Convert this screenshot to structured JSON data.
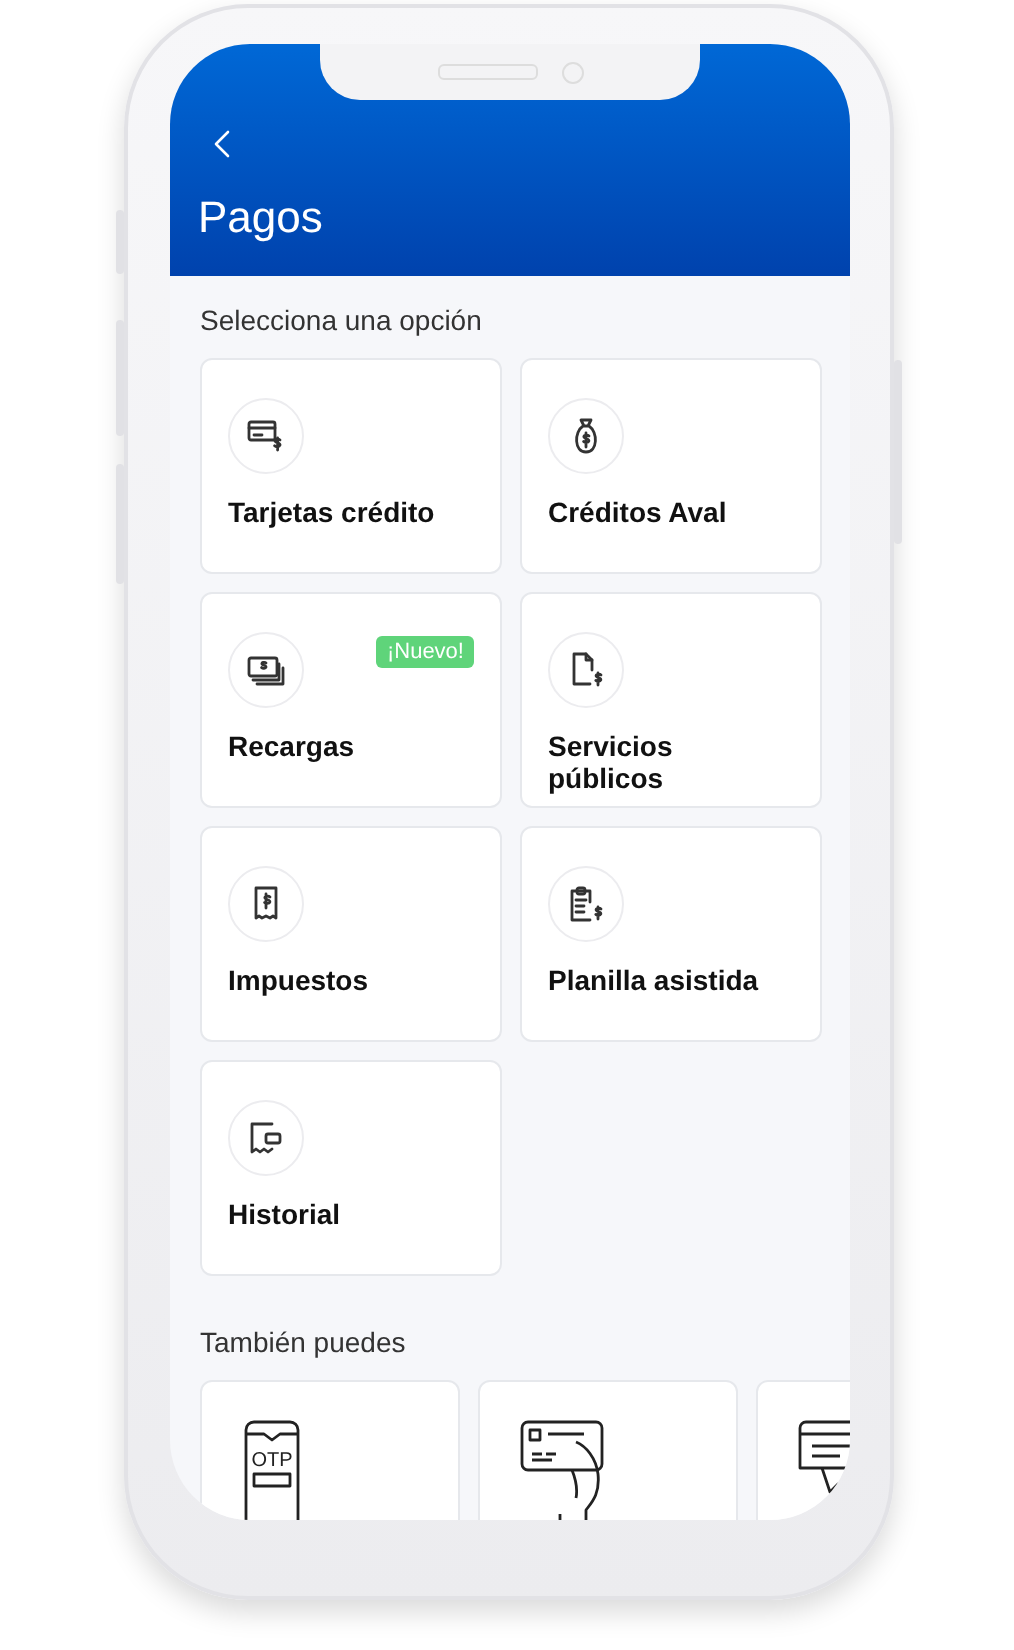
{
  "header": {
    "title": "Pagos"
  },
  "section_title": "Selecciona una opción",
  "options": [
    {
      "kind": "card",
      "label": "Tarjetas crédito"
    },
    {
      "kind": "bag",
      "label": "Créditos Aval"
    },
    {
      "kind": "cash",
      "label": "Recargas",
      "badge": "¡Nuevo!"
    },
    {
      "kind": "file",
      "label": "Servicios públicos"
    },
    {
      "kind": "receipt",
      "label": "Impuestos"
    },
    {
      "kind": "clipboard",
      "label": "Planilla asistida"
    },
    {
      "kind": "history",
      "label": "Historial"
    }
  ],
  "also_title": "También puedes",
  "also_options": [
    {
      "kind": "otp",
      "icon_text": "OTP"
    },
    {
      "kind": "hand_card"
    },
    {
      "kind": "card_cut"
    }
  ]
}
